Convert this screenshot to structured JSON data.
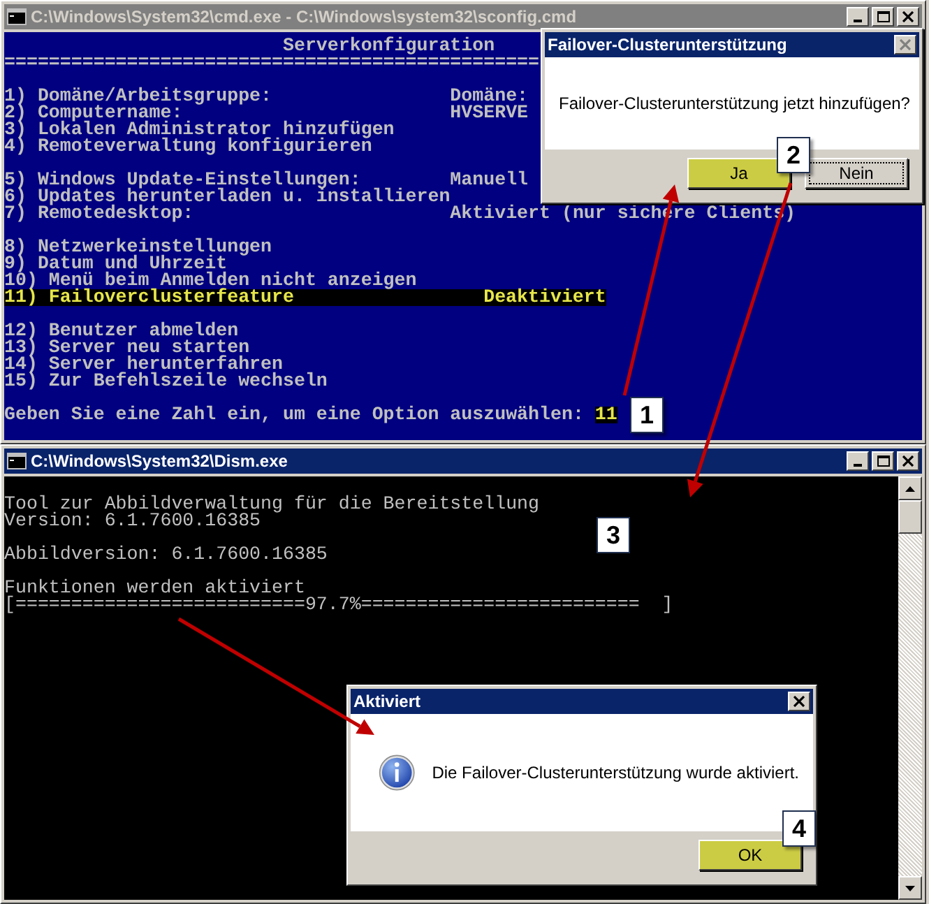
{
  "windows": [
    {
      "kind": "menu",
      "active": false,
      "title": "C:\\Windows\\System32\\cmd.exe - C:\\Windows\\system32\\sconfig.cmd",
      "heading": "Serverkonfiguration",
      "rule": "================================================",
      "blocks": [
        [
          {
            "text": "1) Domäne/Arbeitsgruppe:",
            "value": "Domäne:",
            "highlighted": false
          },
          {
            "text": "2) Computername:",
            "value": "HVSERVE",
            "highlighted": false
          },
          {
            "text": "3) Lokalen Administrator hinzufügen",
            "highlighted": false
          },
          {
            "text": "4) Remoteverwaltung konfigurieren",
            "highlighted": false
          }
        ],
        [
          {
            "text": "5) Windows Update-Einstellungen:",
            "value": "Manuell",
            "highlighted": false
          },
          {
            "text": "6) Updates herunterladen u. installieren",
            "highlighted": false
          },
          {
            "text": "7) Remotedesktop:",
            "value": "Aktiviert (nur sichere Clients)",
            "highlighted": false
          }
        ],
        [
          {
            "text": "8) Netzwerkeinstellungen",
            "highlighted": false
          },
          {
            "text": "9) Datum und Uhrzeit",
            "highlighted": false
          },
          {
            "text": "10) Menü beim Anmelden nicht anzeigen",
            "highlighted": false
          },
          {
            "text": "11) Failoverclusterfeature",
            "value": "Deaktiviert",
            "highlighted": true
          }
        ],
        [
          {
            "text": "12) Benutzer abmelden",
            "highlighted": false
          },
          {
            "text": "13) Server neu starten",
            "highlighted": false
          },
          {
            "text": "14) Server herunterfahren",
            "highlighted": false
          },
          {
            "text": "15) Zur Befehlszeile wechseln",
            "highlighted": false
          }
        ]
      ],
      "prompt": {
        "text": "Geben Sie eine Zahl ein, um eine Option auszuwählen:",
        "input": "11"
      }
    },
    {
      "kind": "log",
      "active": true,
      "title": "C:\\Windows\\System32\\Dism.exe",
      "blocks": [
        [
          {
            "text": "Tool zur Abbildverwaltung für die Bereitstellung",
            "highlighted": false
          },
          {
            "text": "Version: 6.1.7600.16385",
            "highlighted": false
          }
        ],
        [
          {
            "text": "Abbildversion: 6.1.7600.16385",
            "highlighted": false
          }
        ],
        [
          {
            "text": "Funktionen werden aktiviert",
            "highlighted": false
          },
          {
            "text": "[==========================97.7%=========================  ]",
            "highlighted": false
          }
        ]
      ]
    }
  ],
  "dialogs": [
    {
      "kind": "question",
      "title": "Failover-Clusterunterstützung",
      "close_disabled": true,
      "message": "Failover-Clusterunterstützung jetzt hinzufügen?",
      "buttons": [
        {
          "label": "Ja",
          "highlighted": true,
          "focused": false
        },
        {
          "label": "Nein",
          "highlighted": false,
          "focused": true
        }
      ]
    },
    {
      "kind": "info",
      "title": "Aktiviert",
      "close_disabled": false,
      "message": "Die Failover-Clusterunterstützung wurde aktiviert.",
      "buttons": [
        {
          "label": "OK",
          "highlighted": true,
          "focused": false
        }
      ]
    }
  ],
  "callouts": [
    {
      "label": "1"
    },
    {
      "label": "2"
    },
    {
      "label": "3"
    },
    {
      "label": "4"
    }
  ]
}
